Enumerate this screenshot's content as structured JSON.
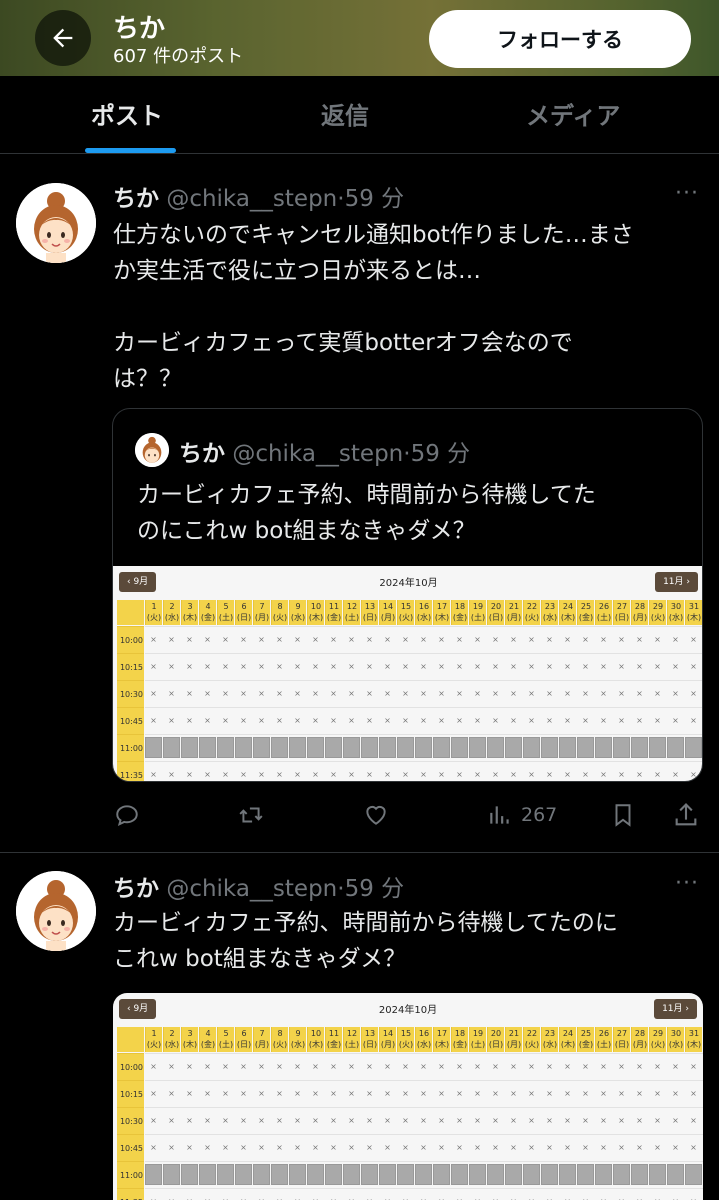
{
  "header": {
    "name": "ちか",
    "post_count": "607 件のポスト",
    "follow_label": "フォローする"
  },
  "tabs": [
    {
      "label": "ポスト",
      "active": true
    },
    {
      "label": "返信",
      "active": false
    },
    {
      "label": "メディア",
      "active": false
    }
  ],
  "posts": [
    {
      "name": "ちか",
      "handle": "@chika__stepn",
      "dot": "·",
      "time": "59 分",
      "more": "···",
      "text": "仕方ないのでキャンセル通知bot作りました…まさ\nか実生活で役に立つ日が来るとは…\n\nカービィカフェって実質botterオフ会なので\nは？？",
      "quote": {
        "name": "ちか",
        "handle": "@chika__stepn",
        "dot": "·",
        "time": "59 分",
        "text": "カービィカフェ予約、時間前から待機してた\nのにこれw bot組まなきゃダメ？"
      },
      "views": "267"
    },
    {
      "name": "ちか",
      "handle": "@chika__stepn",
      "dot": "·",
      "time": "59 分",
      "more": "···",
      "text": "カービィカフェ予約、時間前から待機してたのに\nこれw bot組まなきゃダメ？"
    }
  ],
  "calendar": {
    "title": "2024年10月",
    "prev": "‹ 9月",
    "next": "11月 ›",
    "day_headers": [
      "1\n(火)",
      "2\n(水)",
      "3\n(木)",
      "4\n(金)",
      "5\n(土)",
      "6\n(日)",
      "7\n(月)",
      "8\n(火)",
      "9\n(水)",
      "10\n(木)",
      "11\n(金)",
      "12\n(土)",
      "13\n(日)",
      "14\n(月)",
      "15\n(火)",
      "16\n(水)",
      "17\n(木)",
      "18\n(金)",
      "19\n(土)",
      "20\n(日)",
      "21\n(月)",
      "22\n(火)",
      "23\n(水)",
      "24\n(木)",
      "25\n(金)",
      "26\n(土)",
      "27\n(日)",
      "28\n(月)",
      "29\n(火)",
      "30\n(水)",
      "31\n(木)"
    ],
    "times": [
      "10:00",
      "10:15",
      "10:30",
      "10:45",
      "11:00",
      "11:35"
    ],
    "unavailable_mark": "×",
    "gray_row": "11:00"
  },
  "colors": {
    "bg": "#000000",
    "accent": "#1d9bf0",
    "muted": "#71767b",
    "calendar_header": "#f3d34a"
  }
}
